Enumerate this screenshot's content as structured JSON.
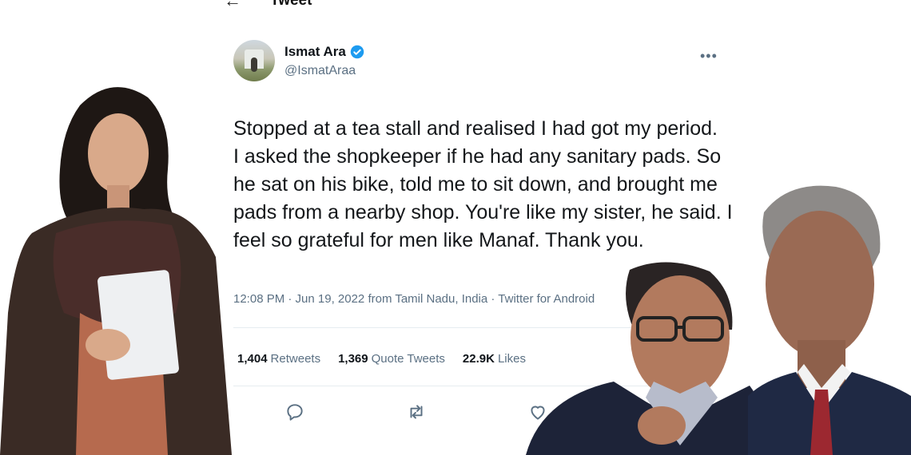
{
  "header": {
    "back_icon": "arrow-left-icon",
    "title": "Tweet"
  },
  "author": {
    "display_name": "Ismat Ara",
    "handle": "@IsmatAraa",
    "verified": true,
    "verified_color": "#1d9bf0"
  },
  "tweet": {
    "lines": [
      "Stopped at a tea stall and realised I had got my period.",
      "I asked the shopkeeper if he had any sanitary pads. So",
      "he sat on his bike, told me to sit down, and brought me",
      "pads from a nearby shop. You're like my sister, he said. I",
      "feel so grateful for men like Manaf. Thank you."
    ],
    "meta": "12:08 PM · Jun 19, 2022 from Tamil Nadu, India · Twitter for Android"
  },
  "stats": [
    {
      "count": "1,404",
      "label": "Retweets"
    },
    {
      "count": "1,369",
      "label": "Quote Tweets"
    },
    {
      "count": "22.9K",
      "label": "Likes"
    }
  ],
  "actions": [
    "reply-icon",
    "retweet-icon",
    "like-icon"
  ],
  "colors": {
    "secondary_text": "#5b7083",
    "divider": "#e6ecf0"
  }
}
